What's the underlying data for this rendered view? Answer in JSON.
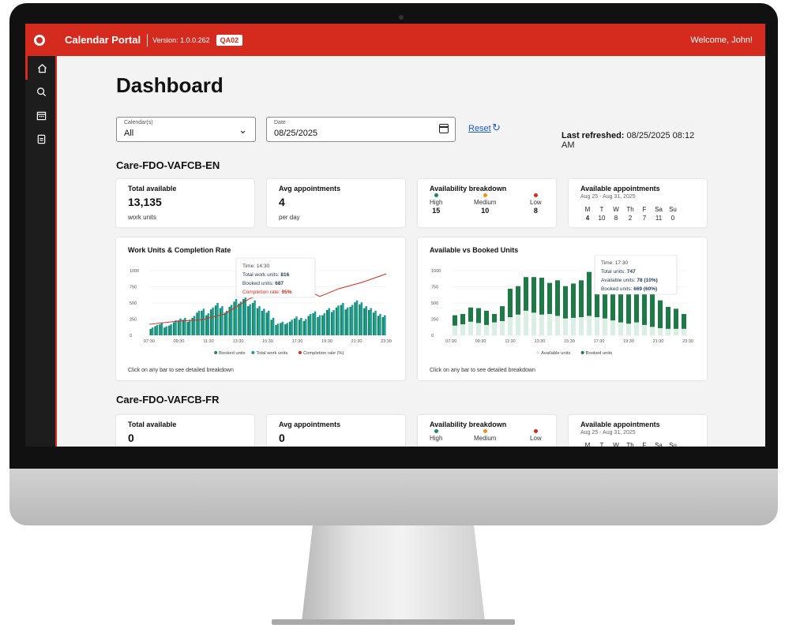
{
  "topbar": {
    "app_title": "Calendar Portal",
    "version": "Version: 1.0.0.262",
    "env_badge": "QA02",
    "welcome": "Welcome, John!"
  },
  "sidebar": {
    "items": [
      {
        "icon": "home-icon"
      },
      {
        "icon": "search-icon"
      },
      {
        "icon": "calendar-icon"
      },
      {
        "icon": "document-icon"
      }
    ]
  },
  "page": {
    "title": "Dashboard"
  },
  "filters": {
    "calendars_label": "Calendar(s)",
    "calendars_value": "All",
    "date_label": "Date",
    "date_value": "08/25/2025",
    "reset_label": "Reset",
    "last_refreshed_label": "Last refreshed:",
    "last_refreshed_value": "08/25/2025 08:12 AM"
  },
  "sections": [
    {
      "title": "Care-FDO-VAFCB-EN",
      "total_available": {
        "title": "Total available",
        "value": "13,135",
        "unit": "work units"
      },
      "avg_appointments": {
        "title": "Avg appointments",
        "value": "4",
        "unit": "per day"
      },
      "availability": {
        "title": "Availability breakdown",
        "high_label": "High",
        "high_value": "15",
        "medium_label": "Medium",
        "medium_value": "10",
        "low_label": "Low",
        "low_value": "8"
      },
      "appointments": {
        "title": "Available appointments",
        "range": "Aug 25 - Aug 31, 2025",
        "days": [
          "M",
          "T",
          "W",
          "Th",
          "F",
          "Sa",
          "Su"
        ],
        "values": [
          "4",
          "10",
          "8",
          "2",
          "7",
          "11",
          "0"
        ]
      },
      "chart1": {
        "title": "Work Units & Completion Rate",
        "footer": "Click on any bar to see detailed breakdown",
        "legend_booked": "Booked units",
        "legend_total": "Total work units",
        "legend_rate": "Completion rate (%)",
        "tooltip_time": "Time: 14:30",
        "tooltip_total_label": "Total work units:",
        "tooltip_total_value": "816",
        "tooltip_booked_label": "Booked units:",
        "tooltip_booked_value": "687",
        "tooltip_rate_label": "Completion rate:",
        "tooltip_rate_value": "95%"
      },
      "chart2": {
        "title": "Available vs Booked Units",
        "footer": "Click on any bar to see detailed breakdown",
        "legend_available": "Available units",
        "legend_booked": "Booked units",
        "tooltip_time": "Time: 17:30",
        "tooltip_total_label": "Total units:",
        "tooltip_total_value": "747",
        "tooltip_available_label": "Available units:",
        "tooltip_available_value": "78 (10%)",
        "tooltip_booked_label": "Booked units:",
        "tooltip_booked_value": "669 (60%)"
      }
    },
    {
      "title": "Care-FDO-VAFCB-FR",
      "total_available": {
        "title": "Total available",
        "value": "0"
      },
      "avg_appointments": {
        "title": "Avg appointments",
        "value": "0"
      },
      "availability": {
        "title": "Availability breakdown",
        "high_label": "High",
        "medium_label": "Medium",
        "low_label": "Low"
      },
      "appointments": {
        "title": "Available appointments",
        "range": "Aug 25 - Aug 31, 2025",
        "days": [
          "M",
          "T",
          "W",
          "Th",
          "F",
          "Sa",
          "Su"
        ]
      }
    }
  ],
  "chart_data": [
    {
      "type": "bar",
      "title": "Work Units & Completion Rate",
      "x_ticks": [
        "07:30",
        "09:30",
        "11:30",
        "13:30",
        "15:30",
        "17:30",
        "19:30",
        "21:30",
        "23:30"
      ],
      "y_ticks": [
        "0",
        "250",
        "500",
        "750",
        "1000"
      ],
      "ylim": [
        0,
        1000
      ],
      "series": [
        {
          "name": "Booked units",
          "color": "#1c8a5a",
          "values": [
            100,
            140,
            170,
            120,
            150,
            200,
            230,
            240,
            210,
            270,
            350,
            380,
            310,
            400,
            460,
            420,
            350,
            440,
            520,
            490,
            560,
            450,
            500,
            420,
            380,
            350,
            240,
            160,
            190,
            170,
            210,
            260,
            240,
            220,
            300,
            340,
            280,
            310,
            390,
            360,
            430,
            470,
            400,
            440,
            510,
            480,
            420,
            390,
            350,
            300,
            280
          ]
        },
        {
          "name": "Total work units",
          "color": "#1a9aa0",
          "values": [
            120,
            160,
            190,
            140,
            170,
            230,
            260,
            270,
            240,
            300,
            380,
            410,
            340,
            430,
            500,
            450,
            380,
            470,
            560,
            520,
            600,
            480,
            540,
            450,
            410,
            380,
            270,
            180,
            210,
            190,
            240,
            290,
            270,
            250,
            330,
            370,
            310,
            340,
            420,
            390,
            460,
            500,
            430,
            470,
            540,
            510,
            450,
            420,
            380,
            330,
            310
          ]
        },
        {
          "name": "Completion rate (%)",
          "color": "#d52b1e",
          "points": [
            [
              0,
              170
            ],
            [
              6,
              220
            ],
            [
              11,
              240
            ],
            [
              16,
              330
            ],
            [
              21,
              560
            ],
            [
              26,
              700
            ],
            [
              31,
              780
            ],
            [
              36,
              600
            ],
            [
              40,
              720
            ],
            [
              45,
              820
            ],
            [
              50,
              950
            ]
          ]
        }
      ]
    },
    {
      "type": "bar",
      "title": "Available vs Booked Units",
      "x_ticks": [
        "07:30",
        "09:30",
        "11:30",
        "13:30",
        "15:30",
        "17:30",
        "19:30",
        "21:30",
        "23:30"
      ],
      "y_ticks": [
        "0",
        "250",
        "500",
        "750",
        "1000"
      ],
      "ylim": [
        0,
        1000
      ],
      "series": [
        {
          "name": "Available units",
          "color": "#d9efe3",
          "values": [
            300,
            320,
            340,
            330,
            300,
            320,
            350,
            380,
            400,
            420,
            440,
            450,
            430,
            420,
            410,
            420,
            430,
            440,
            450,
            460,
            440,
            420,
            400,
            380,
            360,
            340,
            320,
            300,
            300,
            310
          ]
        },
        {
          "name": "Booked units",
          "color": "#1c7a44",
          "bottoms": [
            150,
            170,
            210,
            190,
            160,
            200,
            220,
            280,
            320,
            380,
            350,
            320,
            330,
            300,
            260,
            270,
            280,
            300,
            280,
            260,
            230,
            200,
            180,
            200,
            160,
            130,
            110,
            100,
            100,
            100
          ],
          "tops": [
            310,
            330,
            430,
            420,
            380,
            330,
            450,
            720,
            760,
            900,
            900,
            890,
            810,
            850,
            760,
            800,
            850,
            980,
            930,
            960,
            870,
            820,
            760,
            790,
            720,
            650,
            540,
            440,
            410,
            330
          ]
        }
      ]
    }
  ]
}
